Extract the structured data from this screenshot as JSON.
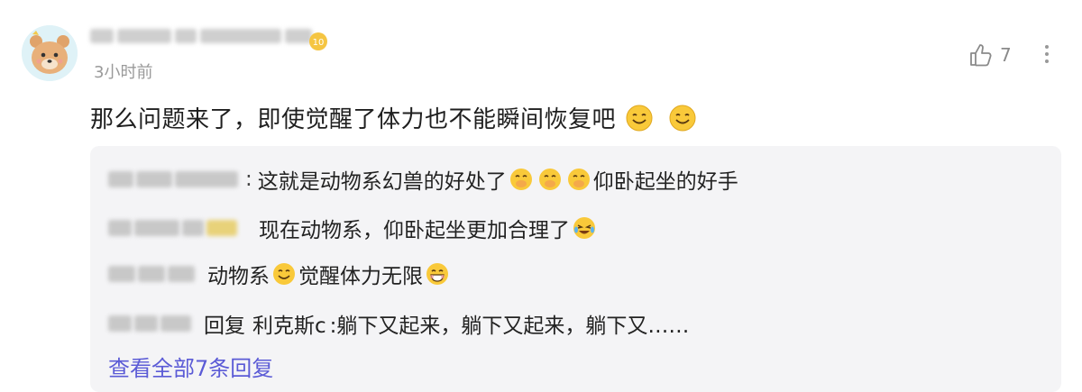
{
  "comment": {
    "time": "3小时前",
    "like_count": "7",
    "level_badge": "10",
    "text": "那么问题来了，即使觉醒了体力也不能瞬间恢复吧",
    "emojis": [
      "smile-emoji",
      "smile-emoji"
    ]
  },
  "replies": [
    {
      "text_a": "这就是动物系幻兽的好处了",
      "emojis": [
        "cover-mouth-emoji",
        "cover-mouth-emoji",
        "cover-mouth-emoji"
      ],
      "text_b": "仰卧起坐的好手"
    },
    {
      "text": "现在动物系，仰卧起坐更加合理了",
      "emojis": [
        "laugh-cry-emoji"
      ]
    },
    {
      "text_a": "动物系",
      "emojis": [
        "smile-emoji",
        "grin-emoji"
      ],
      "text_b": "觉醒体力无限"
    },
    {
      "prefix": "回复",
      "mention": "利克斯c",
      "text": ":躺下又起来，躺下又起来，躺下又……"
    }
  ],
  "view_all": "查看全部7条回复",
  "colors": {
    "link": "#5b5bd6",
    "reply_bg": "#f4f4f6",
    "meta_gray": "#9a9a9a"
  }
}
